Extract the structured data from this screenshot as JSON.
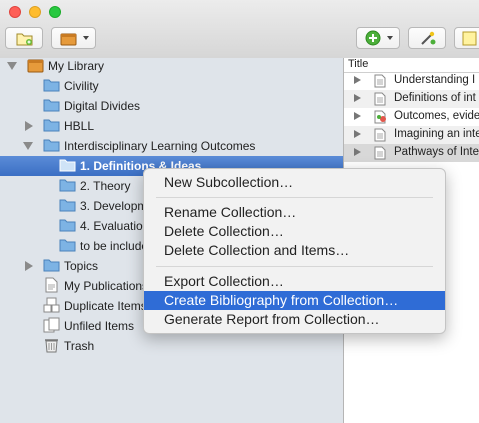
{
  "colors": {
    "selection": "#3b6fc4",
    "menu_highlight": "#2f6cd6",
    "sidebar_bg": "#dfe4ea",
    "traffic_close": "#fe5f57",
    "traffic_min": "#febc2e",
    "traffic_max": "#28c840"
  },
  "toolbar": {
    "new_collection_icon": "new-collection-icon",
    "new_library_icon": "new-library-icon",
    "new_item_icon": "add-circle-icon",
    "add_by_identifier_icon": "magic-wand-icon",
    "new_note_icon": "new-note-icon"
  },
  "tree": {
    "rows": [
      {
        "label": "My Library"
      },
      {
        "label": "Civility"
      },
      {
        "label": "Digital Divides"
      },
      {
        "label": "HBLL"
      },
      {
        "label": "Interdisciplinary Learning Outcomes"
      },
      {
        "label": "1. Definitions & Ideas"
      },
      {
        "label": "2. Theory"
      },
      {
        "label": "3. Developm"
      },
      {
        "label": "4. Evaluation"
      },
      {
        "label": "to be include"
      },
      {
        "label": "Topics"
      },
      {
        "label": "My Publications"
      },
      {
        "label": "Duplicate Items"
      },
      {
        "label": "Unfiled Items"
      },
      {
        "label": "Trash"
      }
    ]
  },
  "items": {
    "header": "Title",
    "rows": [
      {
        "title": "Understanding I"
      },
      {
        "title": "Definitions of int"
      },
      {
        "title": "Outcomes, evide"
      },
      {
        "title": "Imagining an inte"
      },
      {
        "title": "Pathways of Inte"
      }
    ]
  },
  "context_menu": {
    "items": [
      {
        "label": "New Subcollection…"
      },
      {
        "label": "Rename Collection…"
      },
      {
        "label": "Delete Collection…"
      },
      {
        "label": "Delete Collection and Items…"
      },
      {
        "label": "Export Collection…"
      },
      {
        "label": "Create Bibliography from Collection…"
      },
      {
        "label": "Generate Report from Collection…"
      }
    ]
  }
}
